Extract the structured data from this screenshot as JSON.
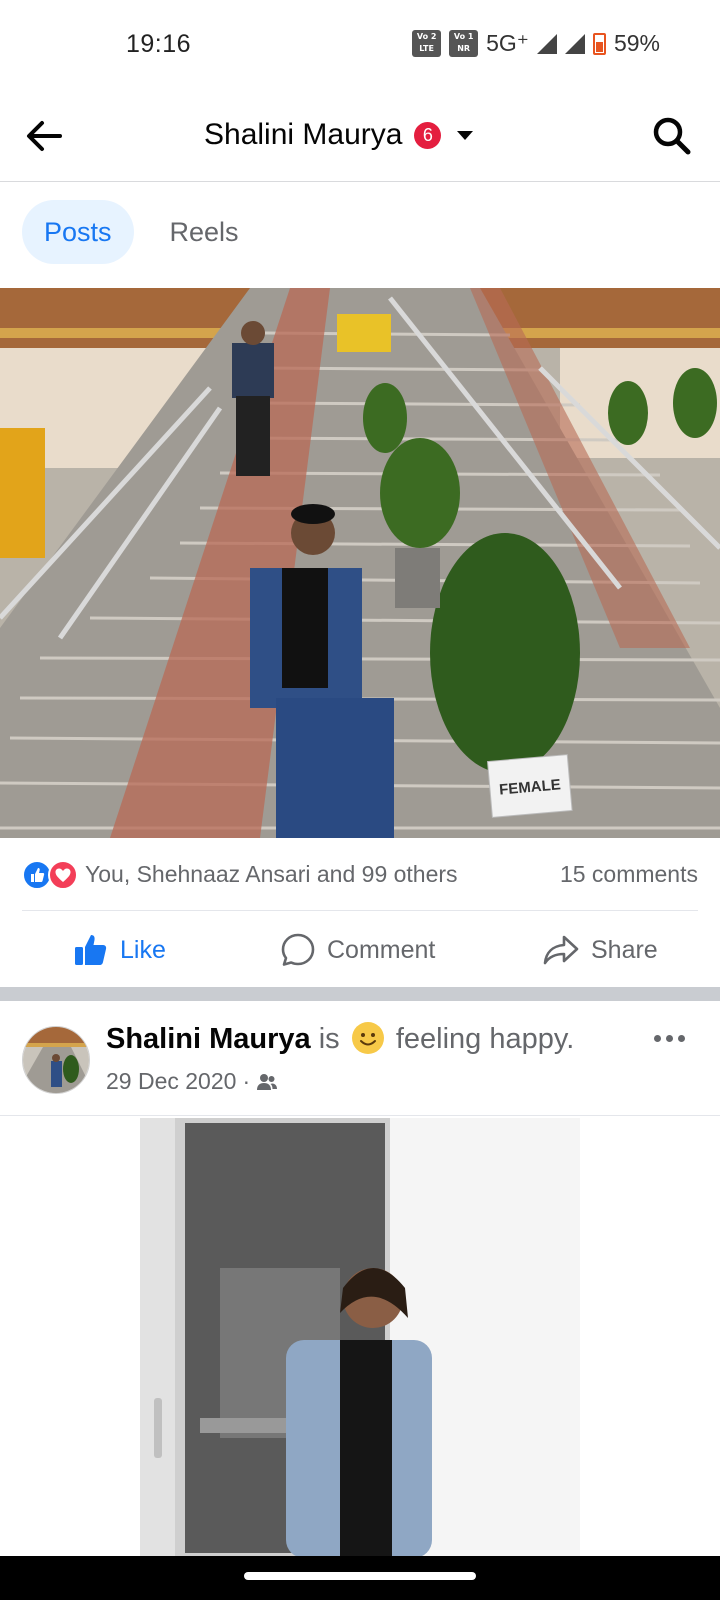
{
  "status_bar": {
    "time": "19:16",
    "sim1": "Vo 2 LTE",
    "sim2": "Vo 1 NR",
    "network": "5G⁺",
    "battery": "59%"
  },
  "header": {
    "title": "Shalini Maurya",
    "badge_count": "6",
    "back_icon": "arrow-left-icon",
    "search_icon": "search-icon",
    "dropdown_icon": "caret-down-icon"
  },
  "tabs": [
    {
      "label": "Posts",
      "active": true
    },
    {
      "label": "Reels",
      "active": false
    }
  ],
  "post1": {
    "photo_sign": "FEMALE",
    "reactions_text": "You, Shehnaaz Ansari and 99 others",
    "comments_count": "15 comments",
    "actions": {
      "like": "Like",
      "comment": "Comment",
      "share": "Share"
    }
  },
  "post2": {
    "author": "Shalini Maurya",
    "verb": "is",
    "feeling": "feeling happy.",
    "date": "29 Dec 2020",
    "separator": "·",
    "audience_icon": "friends-icon",
    "more_icon": "more-horizontal-icon"
  },
  "colors": {
    "accent": "#1877f2",
    "badge": "#e41e3f",
    "muted_text": "#65676b",
    "tab_active_bg": "#e7f3ff"
  }
}
